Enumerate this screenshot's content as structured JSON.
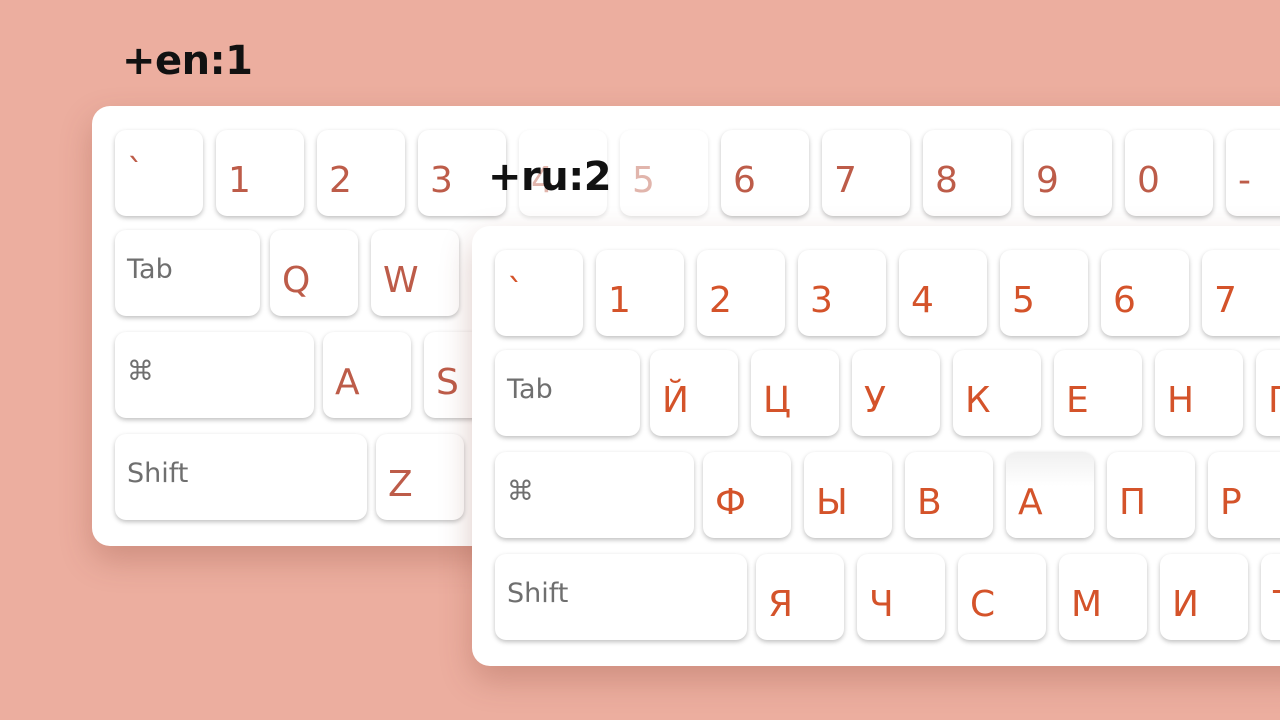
{
  "layouts": {
    "en": {
      "label": "+en:1",
      "row0": [
        "`",
        "1",
        "2",
        "3",
        "4",
        "5",
        "6",
        "7",
        "8",
        "9",
        "0",
        "-"
      ],
      "row1": [
        "Tab",
        "Q",
        "W"
      ],
      "row2": [
        "⌘",
        "A",
        "S"
      ],
      "row3": [
        "Shift",
        "Z"
      ]
    },
    "ru": {
      "label": "+ru:2",
      "row0": [
        "`",
        "1",
        "2",
        "3",
        "4",
        "5",
        "6",
        "7"
      ],
      "row1": [
        "Tab",
        "Й",
        "Ц",
        "У",
        "К",
        "Е",
        "Н",
        "Г"
      ],
      "row2": [
        "⌘",
        "Ф",
        "Ы",
        "В",
        "А",
        "П",
        "Р"
      ],
      "row3": [
        "Shift",
        "Я",
        "Ч",
        "С",
        "М",
        "И",
        "Т"
      ]
    }
  },
  "colors": {
    "background": "#ecae9f",
    "en_key_text": "#bd5c49",
    "ru_key_text": "#d4532a",
    "modifier_text": "#6f6f6f"
  }
}
